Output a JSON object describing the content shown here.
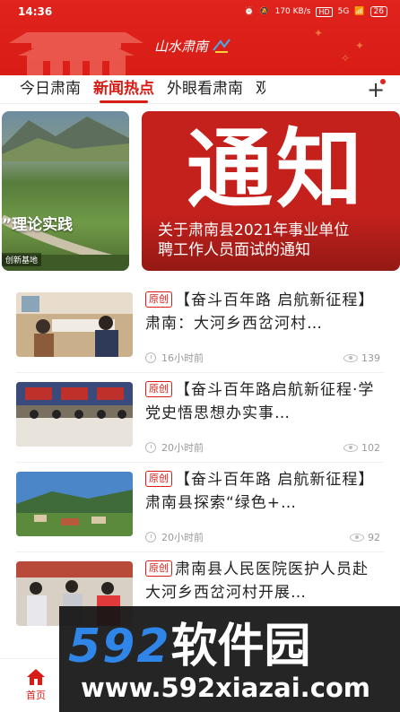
{
  "status_bar": {
    "time": "14:36",
    "net_speed": "170 KB/s",
    "hd": "HD",
    "signal": "5G",
    "battery": "26"
  },
  "header": {
    "logo_text": "山水肃南"
  },
  "tabs": [
    {
      "label": "今日肃南",
      "active": false
    },
    {
      "label": "新闻热点",
      "active": true
    },
    {
      "label": "外眼看肃南",
      "active": false
    },
    {
      "label": "观",
      "active": false
    }
  ],
  "add_tab_icon": "plus-icon",
  "carousel": {
    "left_slide": {
      "caption": "”理论实践",
      "tagline": "创新基地"
    },
    "main_slide": {
      "big_text": "通知",
      "title_line1": "关于肃南县2021年事业单位",
      "title_line2": "聘工作人员面试的通知"
    }
  },
  "news": [
    {
      "tag": "原创",
      "title": "【奋斗百年路 启航新征程】肃南：大河乡西岔河村…",
      "time": "16小时前",
      "views": "139"
    },
    {
      "tag": "原创",
      "title": "【奋斗百年路启航新征程·学党史悟思想办实事…",
      "time": "20小时前",
      "views": "102"
    },
    {
      "tag": "原创",
      "title": "【奋斗百年路 启航新征程】肃南县探索“绿色+…",
      "time": "20小时前",
      "views": "92"
    },
    {
      "tag": "原创",
      "title": "肃南县人民医院医护人员赴大河乡西岔河村开展…",
      "time": "",
      "views": ""
    }
  ],
  "bottom_nav": {
    "home_label": "首页",
    "home_icon": "home-icon"
  },
  "watermark": {
    "brand_digits": "592",
    "brand_text": "软件园",
    "url": "www.592xiazai.com"
  },
  "colors": {
    "brand_red": "#d81c16",
    "watermark_blue": "#2f86e8"
  }
}
